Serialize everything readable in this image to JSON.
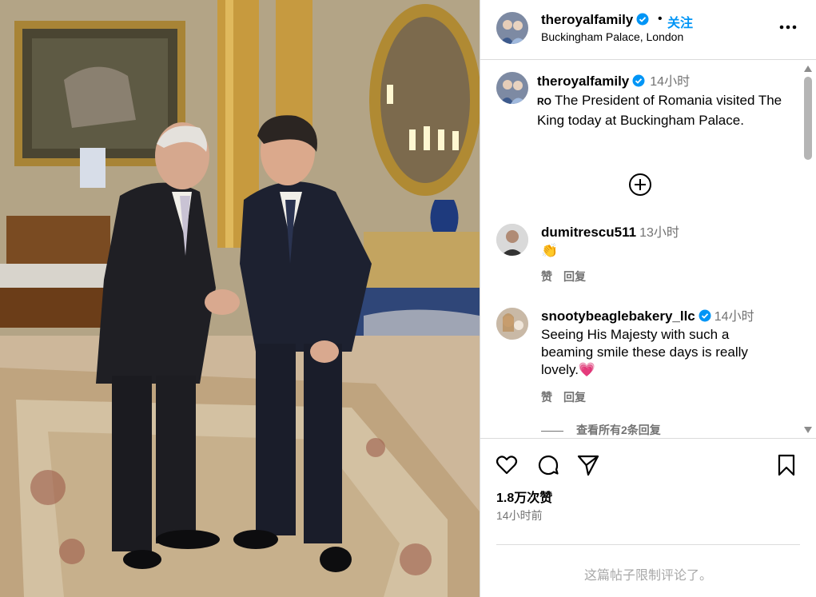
{
  "post": {
    "header": {
      "username": "theroyalfamily",
      "dot": "•",
      "follow_label": "关注",
      "location": "Buckingham Palace, London"
    },
    "caption": {
      "username": "theroyalfamily",
      "time": "14小时",
      "lang_badge": "RO",
      "text": "The President of Romania visited The King today at Buckingham Palace."
    },
    "comments": [
      {
        "username": "dumitrescu511",
        "time": "13小时",
        "text": "👏",
        "like_label": "赞",
        "reply_label": "回复",
        "verified": false
      },
      {
        "username": "snootybeaglebakery_llc",
        "time": "14小时",
        "text": "Seeing His Majesty with such a beaming smile these days is really lovely.💗",
        "like_label": "赞",
        "reply_label": "回复",
        "verified": true
      }
    ],
    "view_replies_label": "查看所有2条回复",
    "likes": "1.8万次赞",
    "posted_ago": "14小时前",
    "comments_disabled": "这篇帖子限制评论了。"
  },
  "icons": {
    "like": "heart-icon",
    "comment": "comment-icon",
    "share": "share-icon",
    "save": "bookmark-icon",
    "more": "more-options-icon",
    "load_more": "plus-circle-icon",
    "verified": "verified-badge-icon"
  },
  "colors": {
    "accent": "#0095f6",
    "secondary_text": "#737373",
    "border": "#dbdbdb",
    "muted": "#a8a8a8"
  }
}
